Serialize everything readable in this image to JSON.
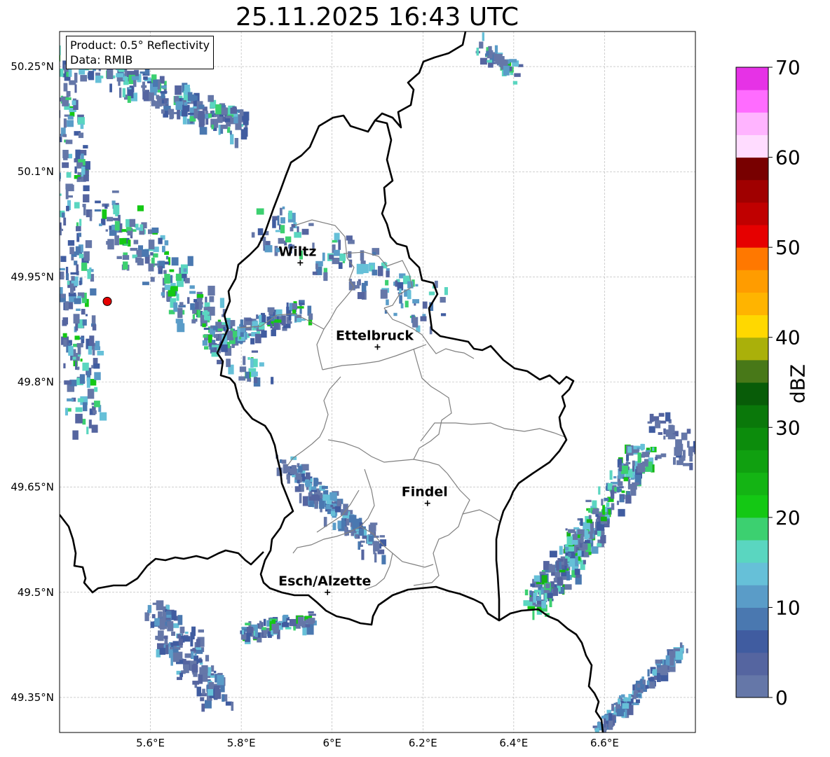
{
  "title": "25.11.2025 16:43 UTC",
  "info": {
    "product": "Product: 0.5° Reflectivity",
    "source": "Data: RMIB"
  },
  "colorbar": {
    "label": "dBZ",
    "ticks": [
      "0",
      "10",
      "20",
      "30",
      "40",
      "50",
      "60",
      "70"
    ],
    "colors": [
      "#6577a8",
      "#5565a0",
      "#405ca0",
      "#4a78b0",
      "#5a9cc8",
      "#66c0d8",
      "#5ad6c0",
      "#3cd070",
      "#14c814",
      "#14b414",
      "#10a010",
      "#0c8c0c",
      "#0a780a",
      "#085c08",
      "#487818",
      "#aab00a",
      "#ffd800",
      "#ffb400",
      "#ff9c00",
      "#ff7800",
      "#e60000",
      "#c00000",
      "#a00000",
      "#780000",
      "#ffdcff",
      "#ffb4ff",
      "#ff6cff",
      "#e632e6"
    ]
  },
  "axes": {
    "lon_ticks": [
      "5.6°E",
      "5.8°E",
      "6°E",
      "6.2°E",
      "6.4°E",
      "6.6°E"
    ],
    "lat_ticks": [
      "50.25°N",
      "50.1°N",
      "49.95°N",
      "49.8°N",
      "49.65°N",
      "49.5°N",
      "49.35°N"
    ],
    "lon_range": [
      5.4,
      6.8
    ],
    "lat_range": [
      49.3,
      50.3
    ]
  },
  "cities": [
    {
      "name": "Wiltz",
      "lon": 5.93,
      "lat": 49.97
    },
    {
      "name": "Ettelbruck",
      "lon": 6.1,
      "lat": 49.85
    },
    {
      "name": "Findel",
      "lon": 6.21,
      "lat": 49.627
    },
    {
      "name": "Esch/Alzette",
      "lon": 5.99,
      "lat": 49.5
    }
  ],
  "radar_site": {
    "lon": 5.505,
    "lat": 49.915,
    "color": "#e60000"
  },
  "colors": {
    "border": "#000000",
    "cantons": "#808080",
    "grid": "#b0b0b0"
  }
}
